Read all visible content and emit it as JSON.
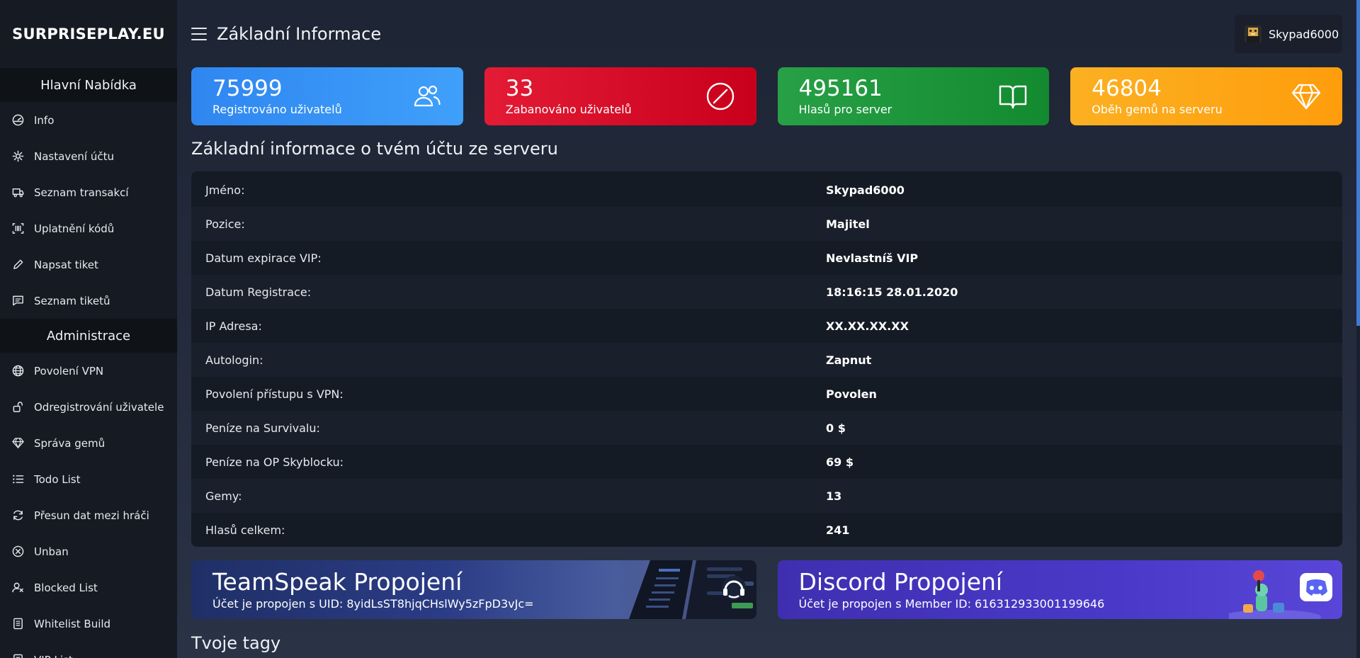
{
  "brand": "SURPRISEPLAY.EU",
  "sidebar": {
    "sections": [
      {
        "title": "Hlavní Nabídka",
        "items": [
          {
            "label": "Info",
            "icon": "dashboard-icon"
          },
          {
            "label": "Nastavení účtu",
            "icon": "gear-icon"
          },
          {
            "label": "Seznam transakcí",
            "icon": "truck-icon"
          },
          {
            "label": "Uplatnění kódů",
            "icon": "barcode-icon"
          },
          {
            "label": "Napsat tiket",
            "icon": "pencil-icon"
          },
          {
            "label": "Seznam tiketů",
            "icon": "message-icon"
          }
        ]
      },
      {
        "title": "Administrace",
        "items": [
          {
            "label": "Povolení VPN",
            "icon": "globe-icon"
          },
          {
            "label": "Odregistrování uživatele",
            "icon": "unlock-icon"
          },
          {
            "label": "Správa gemů",
            "icon": "gem-icon"
          },
          {
            "label": "Todo List",
            "icon": "list-icon"
          },
          {
            "label": "Přesun dat mezi hráči",
            "icon": "refresh-icon"
          },
          {
            "label": "Unban",
            "icon": "x-circle-icon"
          },
          {
            "label": "Blocked List",
            "icon": "user-block-icon"
          },
          {
            "label": "Whitelist Build",
            "icon": "document-icon"
          },
          {
            "label": "VIP List",
            "icon": "document-icon"
          }
        ]
      }
    ]
  },
  "header": {
    "title": "Základní Informace",
    "user": "Skypad6000"
  },
  "stats": [
    {
      "value": "75999",
      "label": "Registrováno uživatelů",
      "icon": "users-icon",
      "color_from": "#2f86f0",
      "color_to": "#3fa0fa"
    },
    {
      "value": "33",
      "label": "Zabanováno uživatelů",
      "icon": "ban-icon",
      "color_from": "#e31b35",
      "color_to": "#c8001c"
    },
    {
      "value": "495161",
      "label": "Hlasů pro server",
      "icon": "book-icon",
      "color_from": "#27a046",
      "color_to": "#138a2f"
    },
    {
      "value": "46804",
      "label": "Oběh gemů na serveru",
      "icon": "gem-icon",
      "color_from": "#fbb022",
      "color_to": "#ff9d0c"
    }
  ],
  "account": {
    "title": "Základní informace o tvém účtu ze serveru",
    "rows": [
      {
        "key": "Jméno:",
        "value": "Skypad6000"
      },
      {
        "key": "Pozice:",
        "value": "Majitel"
      },
      {
        "key": "Datum expirace VIP:",
        "value": "Nevlastníš VIP"
      },
      {
        "key": "Datum Registrace:",
        "value": "18:16:15 28.01.2020"
      },
      {
        "key": "IP Adresa:",
        "value": "XX.XX.XX.XX"
      },
      {
        "key": "Autologin:",
        "value": "Zapnut"
      },
      {
        "key": "Povolení přístupu s VPN:",
        "value": "Povolen"
      },
      {
        "key": "Peníze na Survivalu:",
        "value": "0 $"
      },
      {
        "key": "Peníze na OP Skyblocku:",
        "value": "69 $"
      },
      {
        "key": "Gemy:",
        "value": "13"
      },
      {
        "key": "Hlasů celkem:",
        "value": "241"
      }
    ]
  },
  "links": {
    "teamspeak": {
      "title": "TeamSpeak Propojení",
      "text": "Účet je propojen s UID: 8yidLsST8hjqCHslWy5zFpD3vJc="
    },
    "discord": {
      "title": "Discord Propojení",
      "text": "Účet je propojen s Member ID: 616312933001199646"
    }
  },
  "tags_title": "Tvoje tagy",
  "colors": {
    "sidebar": "#161a22",
    "accent": "#3f7bd6"
  }
}
